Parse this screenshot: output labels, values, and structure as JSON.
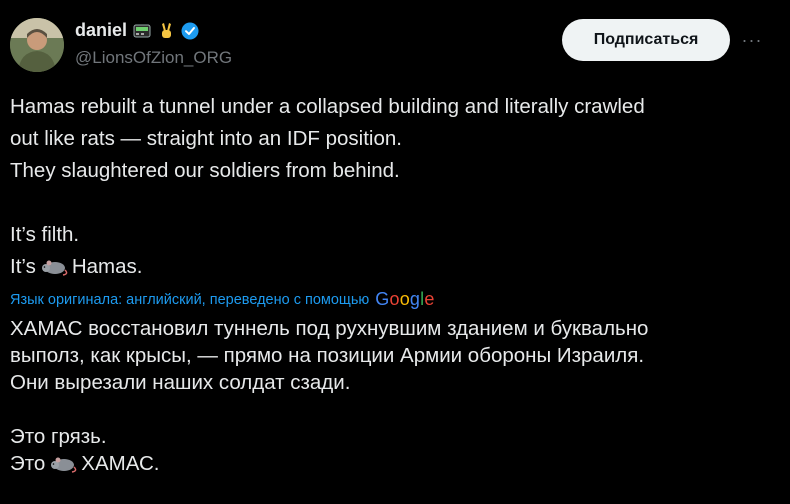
{
  "author": {
    "display_name": "daniel",
    "handle": "@LionsOfZion_ORG",
    "badges": [
      "pager-icon",
      "victory-hand-icon",
      "verified-badge-icon"
    ]
  },
  "actions": {
    "subscribe_label": "Подписаться",
    "more_label": "···"
  },
  "original_text": {
    "line1": "Hamas rebuilt a tunnel under a collapsed building and literally crawled",
    "line2": "out like rats — straight into an IDF position.",
    "line3": "They slaughtered our soldiers from behind.",
    "line4": "It’s filth.",
    "line5_pre": "It’s",
    "line5_post": "Hamas."
  },
  "translation_note": {
    "text": "Язык оригинала: английский, переведено с помощью",
    "provider": "Google"
  },
  "translated_text": {
    "line1": "ХАМАС восстановил туннель под рухнувшим зданием и буквально",
    "line2": "выполз, как крысы, — прямо на позиции Армии обороны Израиля.",
    "line3": "Они вырезали наших солдат сзади.",
    "line4": "Это грязь.",
    "line5_pre": "Это",
    "line5_post": "ХАМАС."
  },
  "colors": {
    "background": "#000000",
    "text": "#e7e9ea",
    "muted": "#71767b",
    "link": "#1d9bf0",
    "button_bg": "#eff3f4"
  }
}
